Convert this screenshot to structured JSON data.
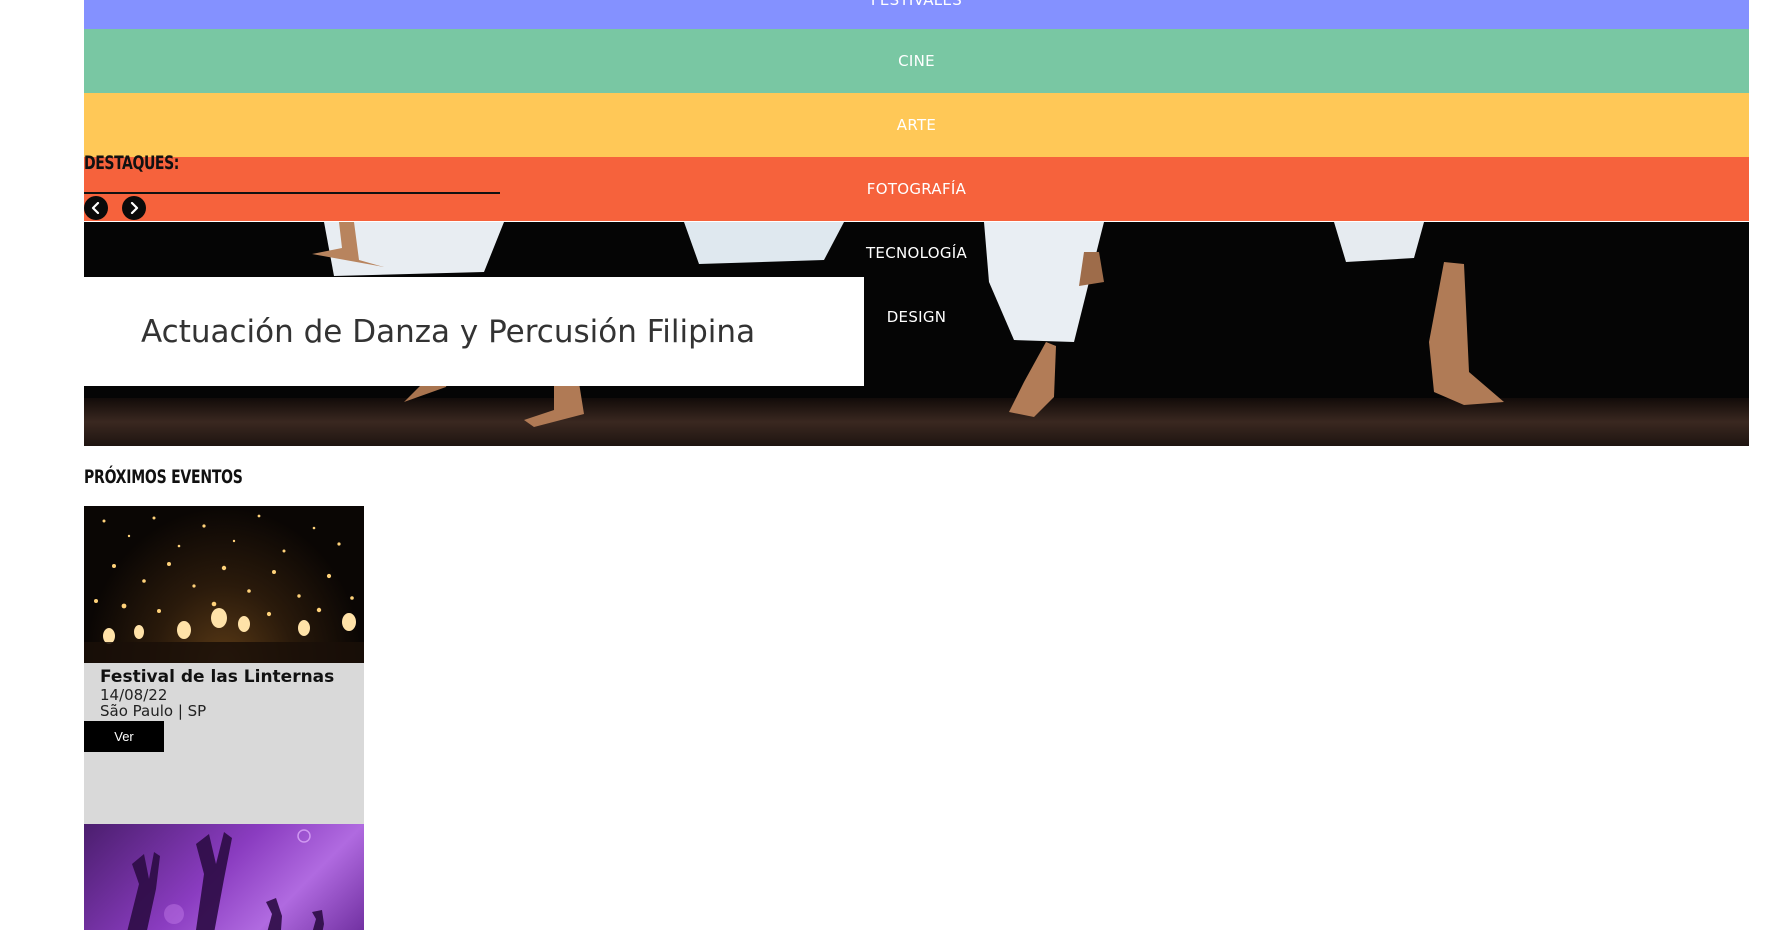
{
  "nav": {
    "items": [
      {
        "label": "FESTIVALES",
        "color": "#8491FF"
      },
      {
        "label": "CINE",
        "color": "#79C7A3"
      },
      {
        "label": "ARTE",
        "color": "#FFC857"
      },
      {
        "label": "FOTOGRAFÍA",
        "color": "#F6623C"
      },
      {
        "label": "TECNOLOGÍA",
        "color": "transparent"
      },
      {
        "label": "DESIGN",
        "color": "transparent"
      }
    ]
  },
  "highlights": {
    "title": "DESTAQUES:",
    "prev_icon": "chevron-left-icon",
    "next_icon": "chevron-right-icon",
    "slide_caption": "Actuación de Danza y Percusión Filipina"
  },
  "upcoming": {
    "title": "PRÓXIMOS EVENTOS",
    "events": [
      {
        "name": "Festival de las Linternas",
        "date": "14/08/22",
        "place": "São Paulo | SP",
        "button": "Ver"
      }
    ]
  }
}
